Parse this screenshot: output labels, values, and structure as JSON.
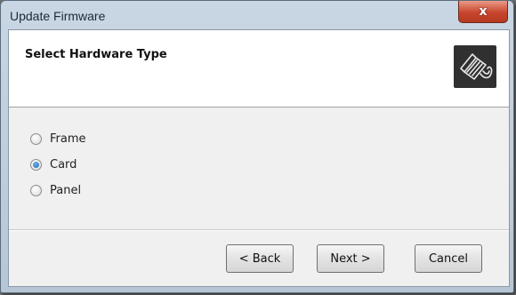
{
  "window": {
    "title": "Update Firmware",
    "close_label": "x"
  },
  "header": {
    "title": "Select Hardware Type",
    "icon": "hardware-cable-icon"
  },
  "options": [
    {
      "label": "Frame",
      "checked": false
    },
    {
      "label": "Card",
      "checked": true
    },
    {
      "label": "Panel",
      "checked": false
    }
  ],
  "buttons": {
    "back": "< Back",
    "next": "Next >",
    "cancel": "Cancel"
  },
  "colors": {
    "close_button": "#c8442c",
    "header_bg": "#ffffff",
    "radio_selected": "#2367b4"
  }
}
